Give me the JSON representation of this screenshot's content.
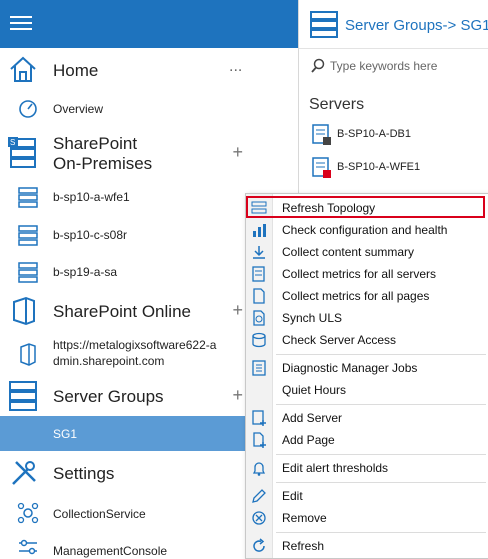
{
  "nav": {
    "home": {
      "label": "Home",
      "more": "..."
    },
    "overview": "Overview",
    "sharepoint_onprem": {
      "line1": "SharePoint",
      "line2": "On-Premises",
      "plus": "+"
    },
    "farm_items": [
      "b-sp10-a-wfe1",
      "b-sp10-c-s08r",
      "b-sp19-a-sa"
    ],
    "sharepoint_online": {
      "label": "SharePoint Online",
      "plus": "+"
    },
    "online_url": {
      "line1": "https://metalogixsoftware622-a",
      "line2": "dmin.sharepoint.com"
    },
    "server_groups": {
      "label": "Server Groups",
      "plus": "+"
    },
    "selected_group": "SG1",
    "settings": "Settings",
    "settings_items": [
      "CollectionService",
      "ManagementConsole"
    ]
  },
  "header": {
    "title": "Server Groups-> SG1"
  },
  "search": {
    "placeholder": "Type keywords here"
  },
  "servers": {
    "heading": "Servers",
    "items": [
      "B-SP10-A-DB1",
      "B-SP10-A-WFE1"
    ]
  },
  "menu": {
    "items": [
      "Refresh Topology",
      "Check configuration and health",
      "Collect content summary",
      "Collect metrics for all servers",
      "Collect metrics for all pages",
      "Synch ULS",
      "Check Server Access",
      "Diagnostic Manager Jobs",
      "Quiet Hours",
      "Add Server",
      "Add Page",
      "Edit alert thresholds",
      "Edit",
      "Remove",
      "Refresh"
    ]
  },
  "colors": {
    "accent": "#1e73be",
    "selected": "#5b9bd5",
    "highlight": "#d9001b"
  }
}
